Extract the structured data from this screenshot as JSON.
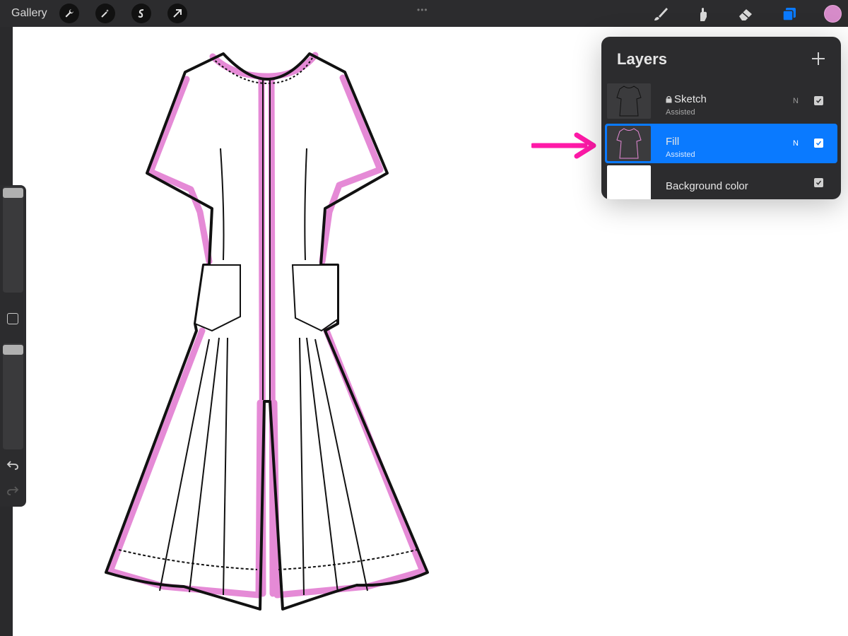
{
  "topbar": {
    "gallery_label": "Gallery",
    "left_tools": [
      "wrench-icon",
      "magic-wand-icon",
      "selection-s-icon",
      "transform-arrow-icon"
    ],
    "right_tools": [
      "brush-icon",
      "smudge-icon",
      "eraser-icon",
      "layers-icon"
    ],
    "current_color": "#d68bc9",
    "accent": "#0a7aff"
  },
  "layers_panel": {
    "title": "Layers",
    "add_icon": "plus-icon",
    "layers": [
      {
        "name": "Sketch",
        "subtitle": "Assisted",
        "blend": "N",
        "locked": true,
        "visible": true,
        "selected": false
      },
      {
        "name": "Fill",
        "subtitle": "Assisted",
        "blend": "N",
        "locked": false,
        "visible": true,
        "selected": true
      },
      {
        "name": "Background color",
        "visible": true,
        "selected": false
      }
    ]
  },
  "sidebar": {
    "tools": [
      "brush-size-slider",
      "modify-square-icon",
      "opacity-slider",
      "undo-icon",
      "redo-icon"
    ]
  },
  "annotation": {
    "arrow_color": "#ff1aa8"
  },
  "drawing": {
    "outline_highlight": "#e58ad6"
  }
}
